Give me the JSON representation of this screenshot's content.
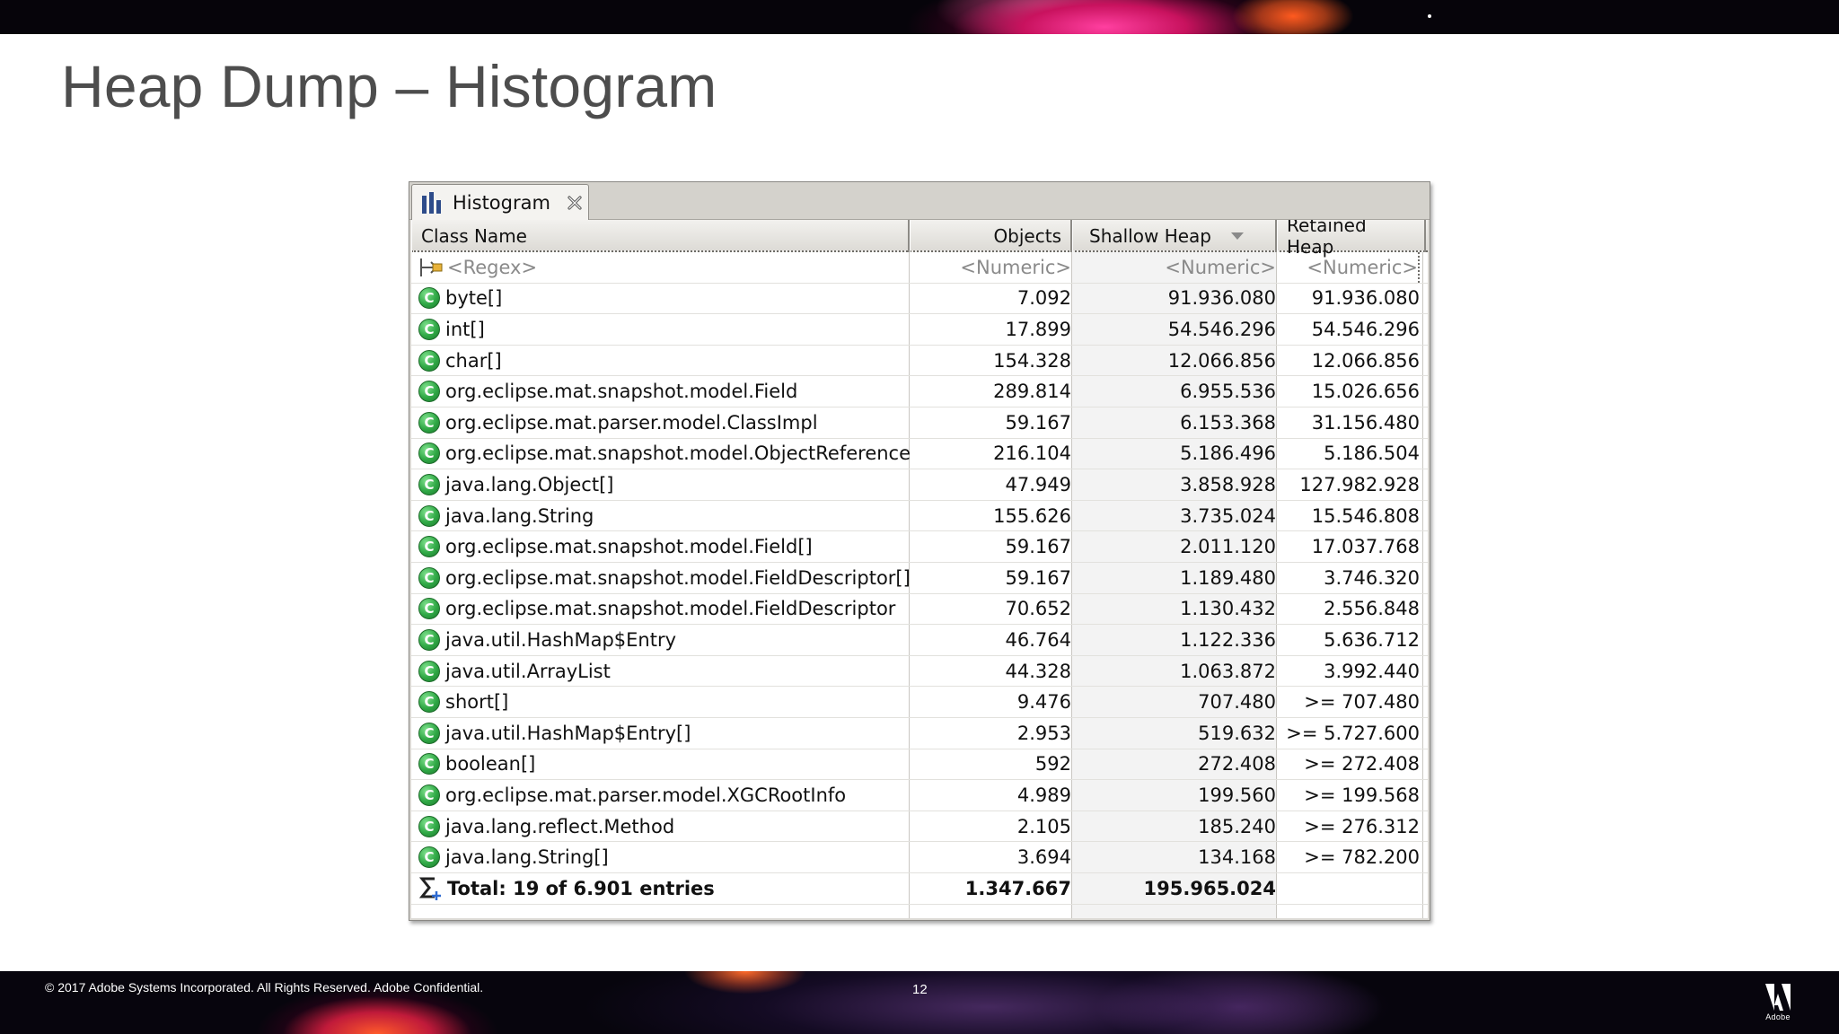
{
  "slide": {
    "title": "Heap Dump – Histogram",
    "copyright": "© 2017 Adobe Systems Incorporated.  All Rights Reserved.  Adobe Confidential.",
    "page_number": "12",
    "logo_icon": "adobe-logo",
    "logo_text": "Adobe"
  },
  "panel": {
    "tab_label": "Histogram",
    "tab_icon": "bar-chart-icon",
    "close_icon": "close-icon",
    "columns": {
      "class_name": "Class Name",
      "objects": "Objects",
      "shallow_heap": "Shallow Heap",
      "retained_heap": "Retained Heap"
    },
    "sort_column": "shallow_heap",
    "sort_direction": "descending",
    "filter": {
      "class_name": "<Regex>",
      "objects": "<Numeric>",
      "shallow_heap": "<Numeric>",
      "retained_heap": "<Numeric>"
    },
    "rows": [
      {
        "name": "byte[]",
        "objects": "7.092",
        "shallow": "91.936.080",
        "retained": "91.936.080"
      },
      {
        "name": "int[]",
        "objects": "17.899",
        "shallow": "54.546.296",
        "retained": "54.546.296"
      },
      {
        "name": "char[]",
        "objects": "154.328",
        "shallow": "12.066.856",
        "retained": "12.066.856"
      },
      {
        "name": "org.eclipse.mat.snapshot.model.Field",
        "objects": "289.814",
        "shallow": "6.955.536",
        "retained": "15.026.656"
      },
      {
        "name": "org.eclipse.mat.parser.model.ClassImpl",
        "objects": "59.167",
        "shallow": "6.153.368",
        "retained": "31.156.480"
      },
      {
        "name": "org.eclipse.mat.snapshot.model.ObjectReference",
        "objects": "216.104",
        "shallow": "5.186.496",
        "retained": "5.186.504"
      },
      {
        "name": "java.lang.Object[]",
        "objects": "47.949",
        "shallow": "3.858.928",
        "retained": "127.982.928"
      },
      {
        "name": "java.lang.String",
        "objects": "155.626",
        "shallow": "3.735.024",
        "retained": "15.546.808"
      },
      {
        "name": "org.eclipse.mat.snapshot.model.Field[]",
        "objects": "59.167",
        "shallow": "2.011.120",
        "retained": "17.037.768"
      },
      {
        "name": "org.eclipse.mat.snapshot.model.FieldDescriptor[]",
        "objects": "59.167",
        "shallow": "1.189.480",
        "retained": "3.746.320"
      },
      {
        "name": "org.eclipse.mat.snapshot.model.FieldDescriptor",
        "objects": "70.652",
        "shallow": "1.130.432",
        "retained": "2.556.848"
      },
      {
        "name": "java.util.HashMap$Entry",
        "objects": "46.764",
        "shallow": "1.122.336",
        "retained": "5.636.712"
      },
      {
        "name": "java.util.ArrayList",
        "objects": "44.328",
        "shallow": "1.063.872",
        "retained": "3.992.440"
      },
      {
        "name": "short[]",
        "objects": "9.476",
        "shallow": "707.480",
        "retained": ">= 707.480"
      },
      {
        "name": "java.util.HashMap$Entry[]",
        "objects": "2.953",
        "shallow": "519.632",
        "retained": ">= 5.727.600"
      },
      {
        "name": "boolean[]",
        "objects": "592",
        "shallow": "272.408",
        "retained": ">= 272.408"
      },
      {
        "name": "org.eclipse.mat.parser.model.XGCRootInfo",
        "objects": "4.989",
        "shallow": "199.560",
        "retained": ">= 199.568"
      },
      {
        "name": "java.lang.reflect.Method",
        "objects": "2.105",
        "shallow": "185.240",
        "retained": ">= 276.312"
      },
      {
        "name": "java.lang.String[]",
        "objects": "3.694",
        "shallow": "134.168",
        "retained": ">= 782.200"
      }
    ],
    "total": {
      "label": "Total: 19 of 6.901 entries",
      "objects": "1.347.667",
      "shallow": "195.965.024",
      "retained": ""
    },
    "class_icon_letter": "C",
    "colors": {
      "class_icon": "#2fa845",
      "tab_icon": "#2e4c8a",
      "title": "#4d4d4d"
    }
  }
}
